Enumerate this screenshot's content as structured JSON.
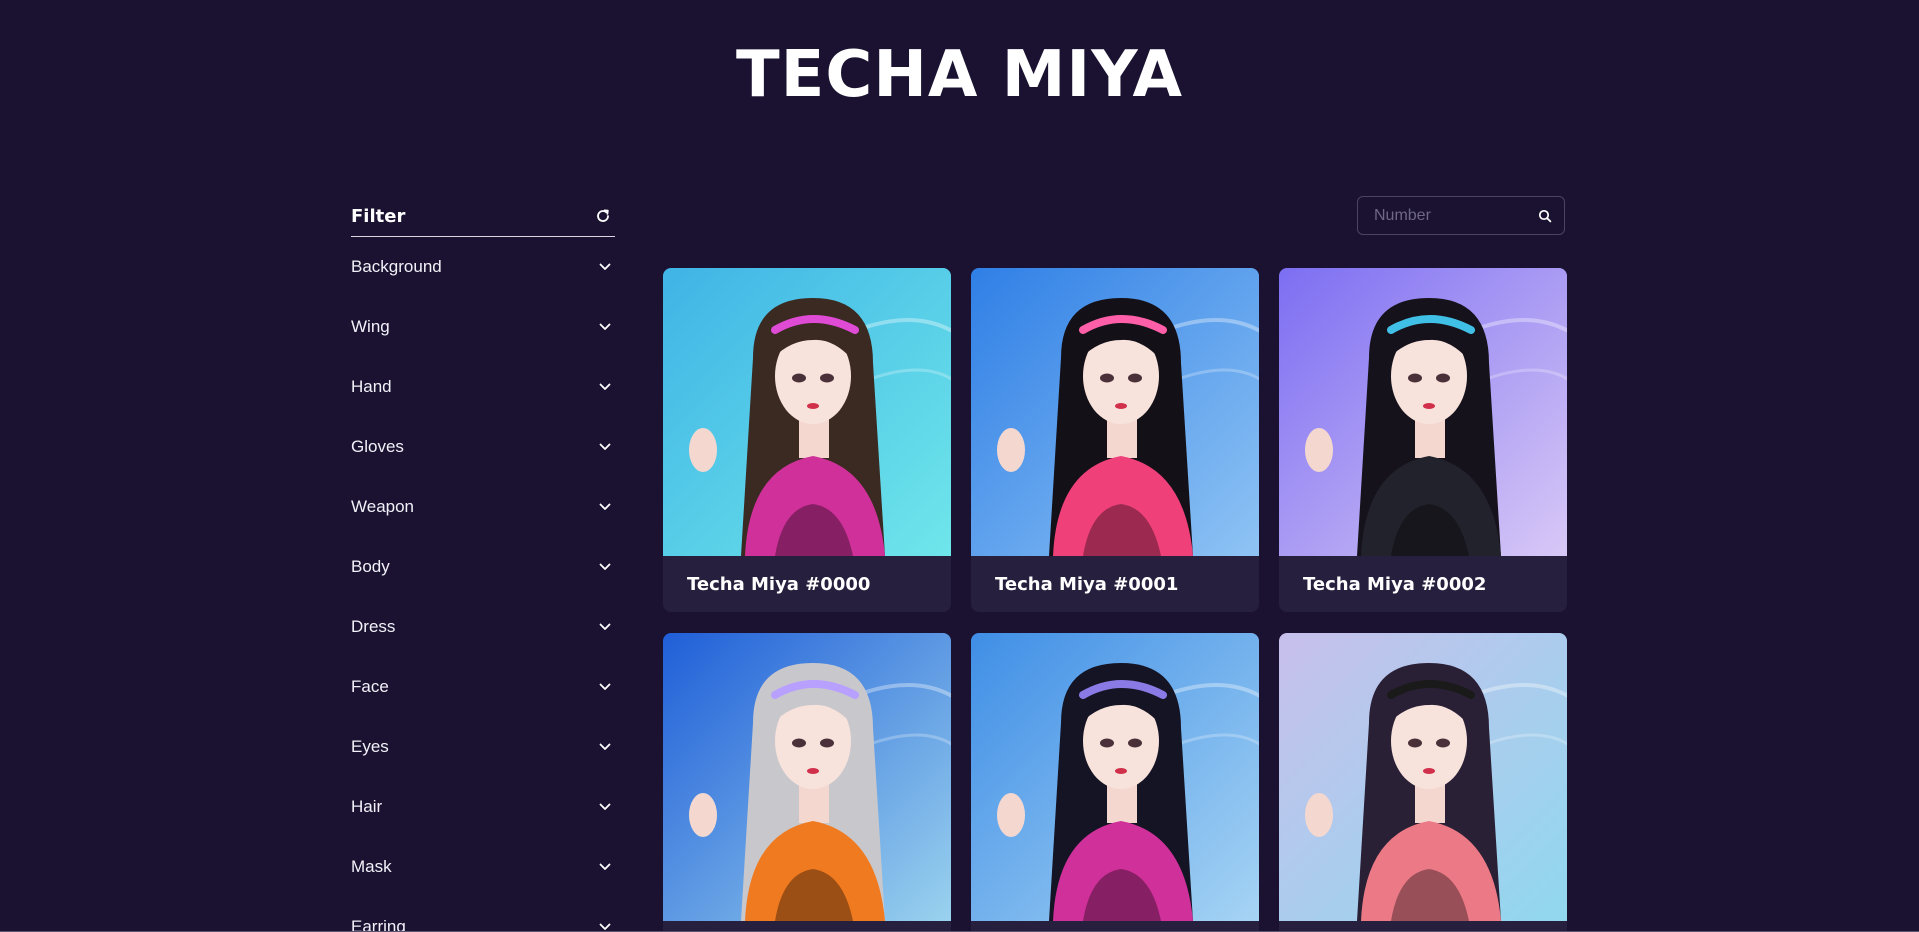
{
  "header": {
    "title": "TECHA MIYA"
  },
  "filter": {
    "title": "Filter",
    "reset_icon": "refresh-icon",
    "items": [
      {
        "label": "Background"
      },
      {
        "label": "Wing"
      },
      {
        "label": "Hand"
      },
      {
        "label": "Gloves"
      },
      {
        "label": "Weapon"
      },
      {
        "label": "Body"
      },
      {
        "label": "Dress"
      },
      {
        "label": "Face"
      },
      {
        "label": "Eyes"
      },
      {
        "label": "Hair"
      },
      {
        "label": "Mask"
      },
      {
        "label": "Earring"
      }
    ]
  },
  "search": {
    "placeholder": "Number",
    "icon": "search-icon"
  },
  "colors": {
    "page_bg": "#1a1230",
    "card_bg": "#261f3d",
    "text": "#ffffff"
  },
  "cards": [
    {
      "name": "Techa Miya #0000",
      "bg_top": "#3fb4e6",
      "bg_bottom": "#6fe6ea",
      "hair": "#3a2a22",
      "outfit": "#d0309a",
      "accent": "#e04bd6"
    },
    {
      "name": "Techa Miya #0001",
      "bg_top": "#2f7fe6",
      "bg_bottom": "#8fc4f4",
      "hair": "#141018",
      "outfit": "#f0407a",
      "accent": "#ff5fa8"
    },
    {
      "name": "Techa Miya #0002",
      "bg_top": "#7c6ef2",
      "bg_bottom": "#d8c8f6",
      "hair": "#16121c",
      "outfit": "#22222c",
      "accent": "#40c0e6"
    },
    {
      "name": "",
      "bg_top": "#1f5ed8",
      "bg_bottom": "#9ad2ee",
      "hair": "#c8c8cc",
      "outfit": "#f07a20",
      "accent": "#b8a0ff"
    },
    {
      "name": "",
      "bg_top": "#3f8ee6",
      "bg_bottom": "#a6d4f4",
      "hair": "#141424",
      "outfit": "#d0309a",
      "accent": "#8a7ae6"
    },
    {
      "name": "",
      "bg_top": "#c8c0ec",
      "bg_bottom": "#90d8ee",
      "hair": "#2a2036",
      "outfit": "#ec7a86",
      "accent": "#1a1a1a"
    }
  ]
}
